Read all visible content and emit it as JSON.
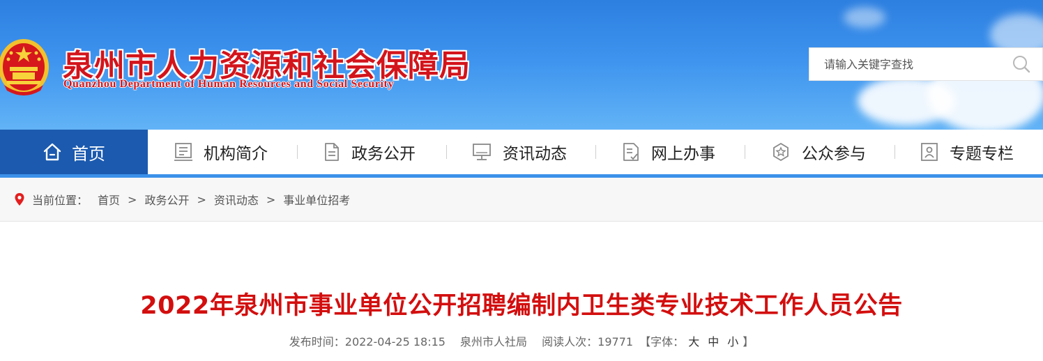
{
  "header": {
    "title_cn": "泉州市人力资源和社会保障局",
    "title_en": "Quanzhou Department of Human Resources and Social Security",
    "emblem_icon": "national-emblem-icon"
  },
  "search": {
    "placeholder": "请输入关键字查找",
    "icon": "search-icon"
  },
  "nav": {
    "home_label": "首页",
    "items": [
      {
        "label": "机构简介",
        "icon": "org-icon"
      },
      {
        "label": "政务公开",
        "icon": "document-icon"
      },
      {
        "label": "资讯动态",
        "icon": "monitor-icon"
      },
      {
        "label": "网上办事",
        "icon": "form-icon"
      },
      {
        "label": "公众参与",
        "icon": "participation-icon"
      },
      {
        "label": "专题专栏",
        "icon": "column-icon"
      }
    ],
    "active_color": "#1b5aaf"
  },
  "breadcrumb": {
    "prefix": "当前位置：",
    "items": [
      "首页",
      "政务公开",
      "资讯动态",
      "事业单位招考"
    ],
    "separator": ">"
  },
  "article": {
    "title": "2022年泉州市事业单位公开招聘编制内卫生类专业技术工作人员公告",
    "publish_label": "发布时间：",
    "publish_time": "2022-04-25 18:15",
    "source": "泉州市人社局",
    "views_label": "阅读人次：",
    "views": "19771",
    "font_label": "【字体：",
    "font_large": "大",
    "font_medium": "中",
    "font_small": "小",
    "font_close": "】",
    "title_color": "#d30e0e"
  }
}
